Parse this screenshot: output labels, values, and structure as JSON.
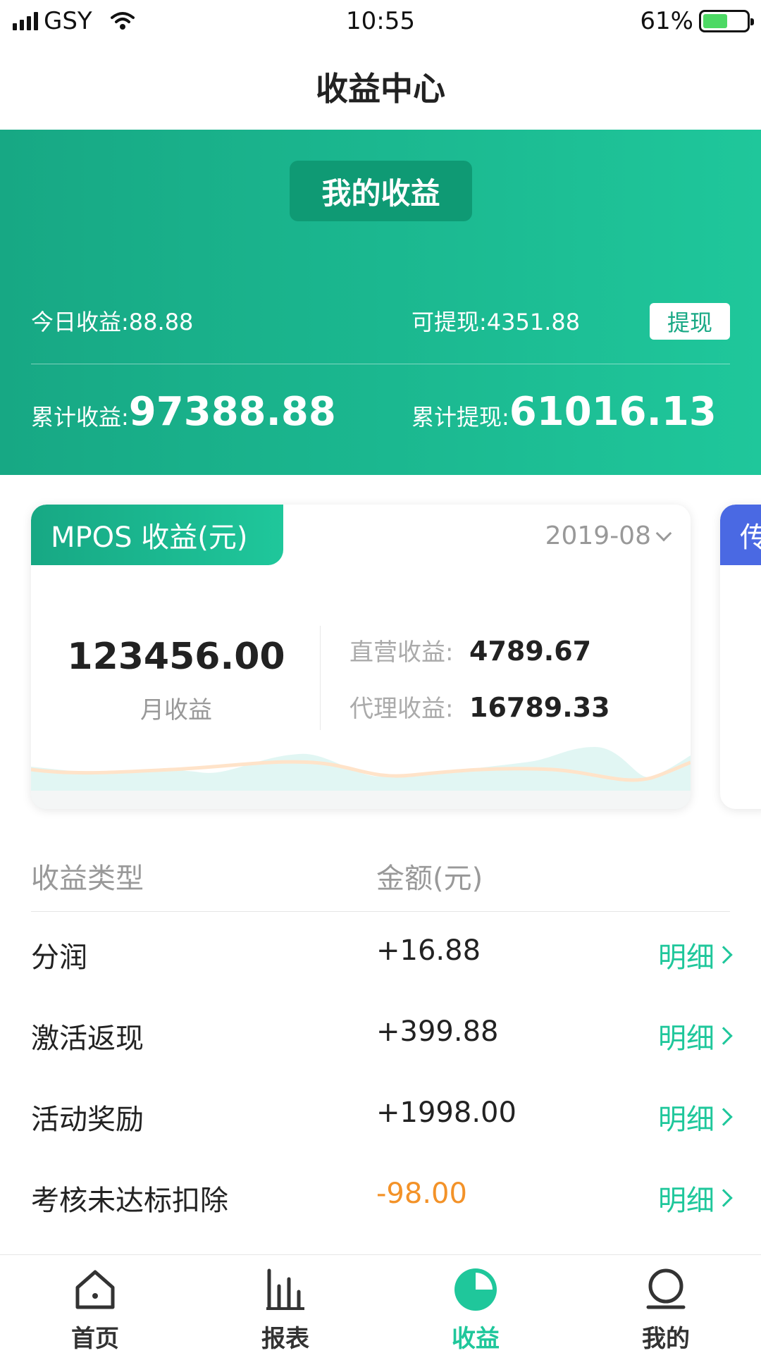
{
  "status_bar": {
    "carrier": "GSY",
    "time": "10:55",
    "battery": "61%",
    "battery_level": 0.61
  },
  "nav": {
    "title": "收益中心"
  },
  "hero": {
    "tab_label": "我的收益",
    "today_label": "今日收益:",
    "today_value": "88.88",
    "withdrawable_label": "可提现:",
    "withdrawable_value": "4351.88",
    "withdraw_button": "提现",
    "total_income_label": "累计收益:",
    "total_income_value": "97388.88",
    "total_withdrawn_label": "累计提现:",
    "total_withdrawn_value": "61016.13"
  },
  "card": {
    "title": "MPOS 收益(元)",
    "date": "2019-08",
    "month_value": "123456.00",
    "month_label": "月收益",
    "direct_label": "直营收益:",
    "direct_value": "4789.67",
    "agent_label": "代理收益:",
    "agent_value": "16789.33"
  },
  "next_card": {
    "title_fragment": "传"
  },
  "table": {
    "headers": [
      "收益类型",
      "金额(元)"
    ],
    "detail_label": "明细",
    "rows": [
      {
        "type": "分润",
        "amount": "+16.88"
      },
      {
        "type": "激活返现",
        "amount": "+399.88"
      },
      {
        "type": "活动奖励",
        "amount": "+1998.00"
      },
      {
        "type": "考核未达标扣除",
        "amount": "-98.00"
      }
    ]
  },
  "tabbar": {
    "items": [
      {
        "label": "首页",
        "icon": "home-icon"
      },
      {
        "label": "报表",
        "icon": "bar-chart-icon"
      },
      {
        "label": "收益",
        "icon": "pie-chart-icon"
      },
      {
        "label": "我的",
        "icon": "user-icon"
      }
    ],
    "active_index": 2,
    "active_color": "#1fc79b"
  },
  "colors": {
    "brand": "#1fc79b",
    "brand_dark": "#17a884",
    "negative": "#f39228",
    "secondary_card": "#4a69e3"
  }
}
